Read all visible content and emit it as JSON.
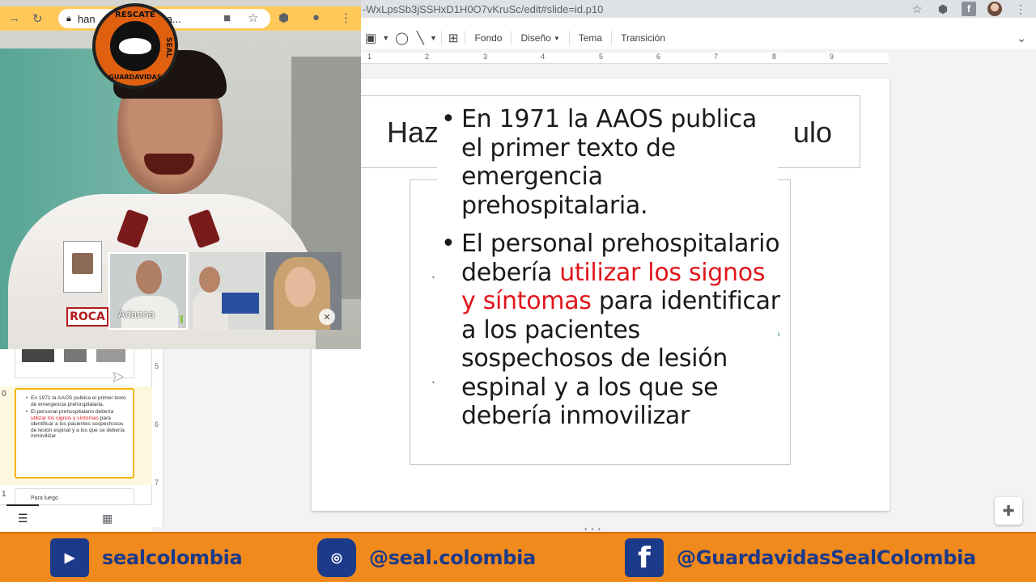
{
  "browser": {
    "url_fragment": "-WxLpsSb3jSSHxD1H0O7vKruSc/edit#slide=id.p10",
    "inner_url": "han",
    "inner_url_tail": "om/ca...",
    "extension_fb_label": "f"
  },
  "toolbar": {
    "fondo": "Fondo",
    "diseno": "Diseño",
    "tema": "Tema",
    "transicion": "Transición"
  },
  "ruler": {
    "h_numbers": [
      "1",
      "2",
      "3",
      "4",
      "5",
      "6",
      "7",
      "8",
      "9"
    ],
    "v_numbers": [
      "5",
      "6",
      "7"
    ]
  },
  "slide": {
    "title_left": "Haz",
    "title_right": "ulo",
    "bullets": [
      {
        "parts": [
          {
            "text": "En 1971 la AAOS publica el primer texto de emergencia prehospitalaria.",
            "color": "normal"
          }
        ]
      },
      {
        "parts": [
          {
            "text": "El personal prehospitalario debería ",
            "color": "normal"
          },
          {
            "text": "utilizar los signos y síntomas",
            "color": "red"
          },
          {
            "text": " para identificar a los pacientes sospechosos de lesión espinal y a los que se debería inmovilizar",
            "color": "normal"
          }
        ]
      }
    ]
  },
  "filmstrip": {
    "current_number": "0",
    "next_number": "1",
    "next_title": "Para luego",
    "thumb_bullets": [
      "En 1971 la AAOS publica el primer texto de emergencia prehospitalaria.",
      "El personal prehospitalario debería"
    ],
    "thumb_red": "utilizar los signos y síntomas",
    "thumb_tail": "para identificar a los pacientes sospechosos de lesión espinal y a los que se debería inmovilizar"
  },
  "video": {
    "logo_top": "RESCATE",
    "logo_bottom": "GUARDAVIDAS",
    "logo_side": "SEAL",
    "badge_text": "ROCA",
    "participants": [
      {
        "name": "Arianna"
      }
    ]
  },
  "footer": {
    "youtube_handle": "sealcolombia",
    "instagram_handle": "@seal.colombia",
    "facebook_handle": "@GuardavidasSealColombia"
  },
  "colors": {
    "accent_red": "#e0161b",
    "banner_orange": "#f08a1c",
    "brand_blue": "#1c3a8a"
  }
}
